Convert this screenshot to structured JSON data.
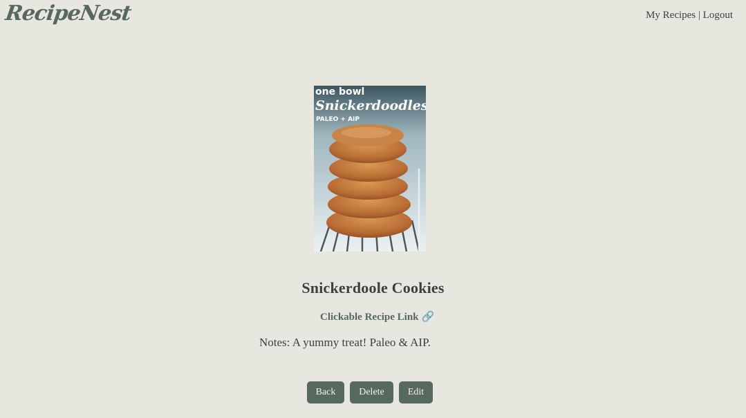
{
  "header": {
    "logo": "RecipeNest",
    "nav": {
      "my_recipes": "My Recipes",
      "separator": "|",
      "logout": "Logout"
    }
  },
  "recipe": {
    "image_caption": {
      "line1": "one bowl",
      "line2": "Snickerdoodles",
      "line3": "PALEO + AIP"
    },
    "title": "Snickerdoole Cookies",
    "link_text": "Clickable Recipe Link",
    "link_icon": "🔗",
    "notes": "Notes: A yummy treat! Paleo & AIP."
  },
  "actions": {
    "back": "Back",
    "delete": "Delete",
    "edit": "Edit"
  },
  "colors": {
    "background": "#e8e7df",
    "accent": "#56695c",
    "text": "#3e3e3e"
  }
}
